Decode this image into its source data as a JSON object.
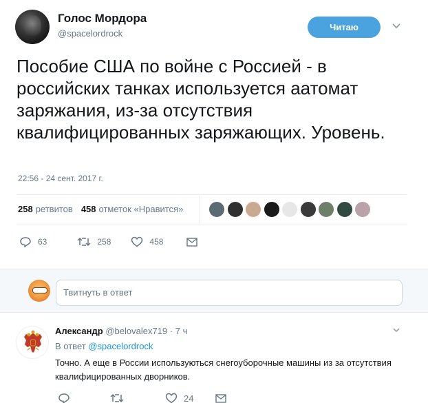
{
  "tweet": {
    "author_name": "Голос Мордора",
    "author_handle": "@spacelordrock",
    "follow_label": "Читаю",
    "text": "Пособие США по войне с Россией - в российских танках используется аатомат заряжания, из-за отсутствия квалифицированных заряжающих. Уровень.",
    "timestamp": "22:56 - 24 сент. 2017 г.",
    "retweets_count": "258",
    "retweets_label": "ретвитов",
    "likes_count": "458",
    "likes_label": "отметок «Нравится»",
    "actions": {
      "reply_count": "63",
      "retweet_count": "258",
      "like_count": "458"
    }
  },
  "reply_box": {
    "placeholder": "Твитнуть в ответ"
  },
  "reply": {
    "author_name": "Александр",
    "author_handle": "@belovalex719",
    "age": "· 7 ч",
    "in_reply_to_prefix": "В ответ",
    "in_reply_to_handle": "@spacelordrock",
    "text": "Точно. А еще в России используються снегоуборочные машины из за отсутствия квалифицированных дворников.",
    "like_count": "24"
  },
  "colors": {
    "accent": "#4aa3df",
    "link": "#1b95e0",
    "muted": "#657786",
    "text": "#14171a"
  },
  "liker_colors": [
    "#5c6b73",
    "#2f2f2f",
    "#c9a98f",
    "#1a1a1a",
    "#e7e7e7",
    "#3b3b3b",
    "#6d7f6a",
    "#2f4a40",
    "#b9a3a8"
  ]
}
